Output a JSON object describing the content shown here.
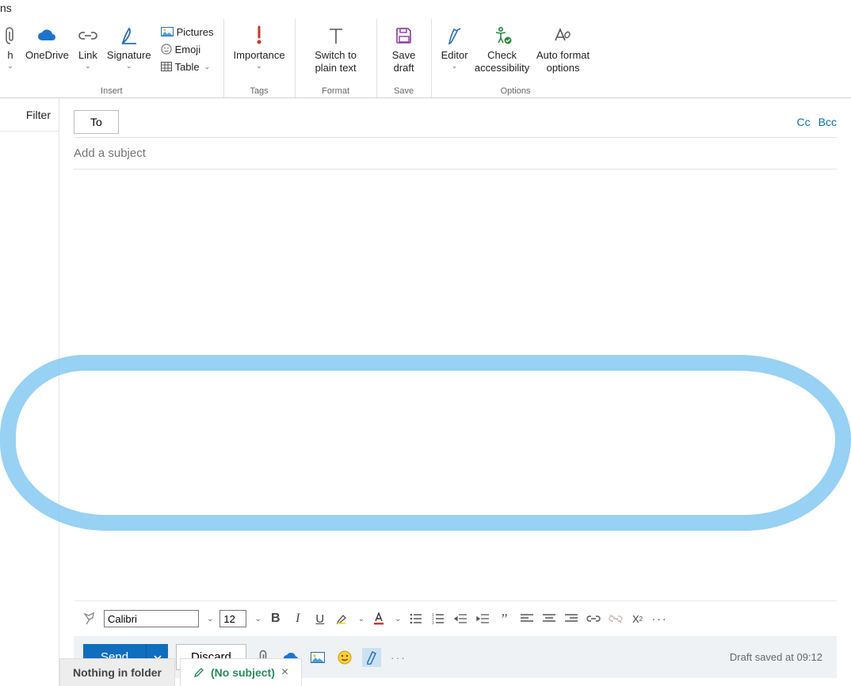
{
  "titlebar": {
    "fragment": "ns"
  },
  "ribbon": {
    "groups": {
      "insert": {
        "label": "Insert",
        "attach_partial": "h",
        "onedrive": "OneDrive",
        "link": "Link",
        "signature": "Signature",
        "pictures": "Pictures",
        "emoji": "Emoji",
        "table": "Table"
      },
      "tags": {
        "label": "Tags",
        "importance": "Importance"
      },
      "format": {
        "label": "Format",
        "switch": "Switch to plain text"
      },
      "save": {
        "label": "Save",
        "savedraft": "Save draft"
      },
      "options": {
        "label": "Options",
        "editor": "Editor",
        "access": "Check accessibility",
        "autoformat": "Auto format options"
      }
    }
  },
  "filter": {
    "label": "Filter"
  },
  "compose": {
    "to_label": "To",
    "cc": "Cc",
    "bcc": "Bcc",
    "subject_placeholder": "Add a subject"
  },
  "format_toolbar": {
    "font_name": "Calibri",
    "font_size": "12"
  },
  "sendbar": {
    "send": "Send",
    "discard": "Discard",
    "draft_status": "Draft saved at 09:12"
  },
  "tabs": {
    "folder": "Nothing in folder",
    "draft": "(No subject)"
  }
}
